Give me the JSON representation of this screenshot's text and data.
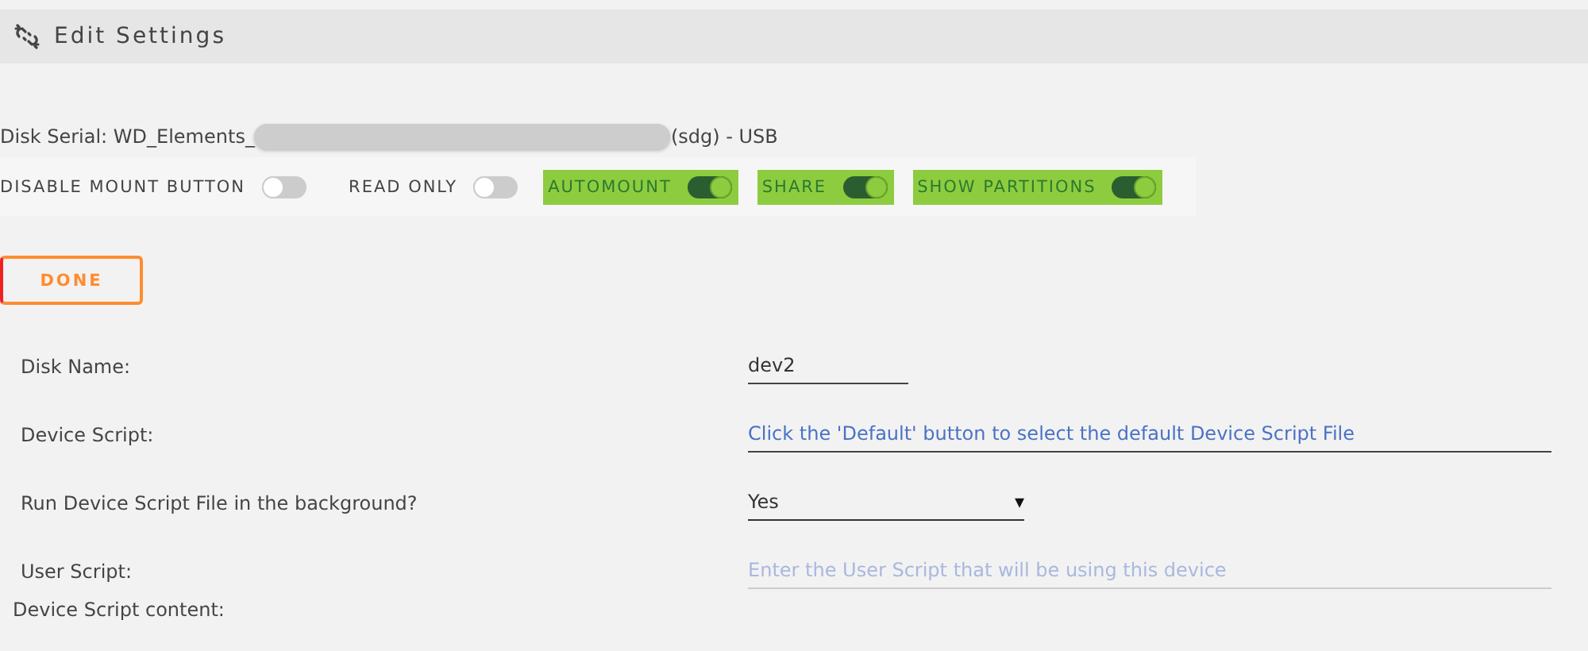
{
  "header": {
    "title": "Edit Settings"
  },
  "disk_serial": {
    "prefix": "Disk Serial: WD_Elements_",
    "suffix": "(sdg) - USB"
  },
  "switches": [
    {
      "label": "DISABLE MOUNT BUTTON",
      "on": false
    },
    {
      "label": "READ ONLY",
      "on": false
    },
    {
      "label": "AUTOMOUNT",
      "on": true
    },
    {
      "label": "SHARE",
      "on": true
    },
    {
      "label": "SHOW PARTITIONS",
      "on": true
    }
  ],
  "done_button": "DONE",
  "fields": [
    {
      "kind": "text",
      "label": "Disk Name:",
      "value": "dev2"
    },
    {
      "kind": "script",
      "label": "Device Script:",
      "placeholder": "Click the 'Default' button to select the default Device Script File"
    },
    {
      "kind": "select",
      "label": "Run Device Script File in the background?",
      "value": "Yes",
      "arrow": "▾"
    },
    {
      "kind": "hint",
      "label": "User Script:",
      "placeholder": "Enter the User Script that will be using this device"
    }
  ],
  "content_label": "Device Script content:"
}
